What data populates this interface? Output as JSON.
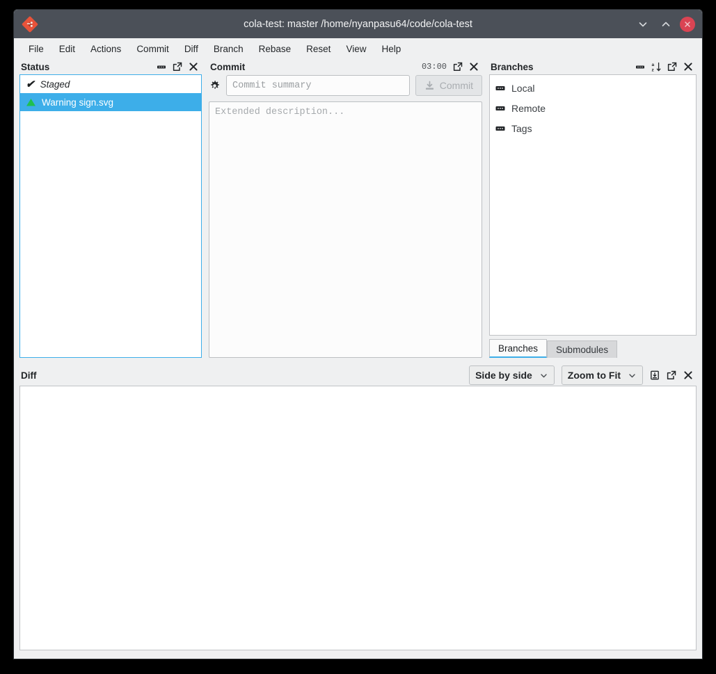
{
  "window": {
    "title": "cola-test: master /home/nyanpasu64/code/cola-test",
    "logo_icon": "git-cola-logo-icon",
    "controls": [
      {
        "name": "minimize-button",
        "icon": "chevron-down-icon"
      },
      {
        "name": "maximize-button",
        "icon": "chevron-up-icon"
      },
      {
        "name": "close-button",
        "icon": "close-x-icon"
      }
    ],
    "titlebar_color": "#4b5058",
    "close_color": "#da4453"
  },
  "menubar": {
    "items": [
      "File",
      "Edit",
      "Actions",
      "Commit",
      "Diff",
      "Branch",
      "Rebase",
      "Reset",
      "View",
      "Help"
    ]
  },
  "status": {
    "title": "Status",
    "icons": [
      "minimize-dock-icon",
      "float-dock-icon",
      "close-dock-icon"
    ],
    "rows": [
      {
        "label": "Staged",
        "icon": "checkmark-icon",
        "selected": false
      },
      {
        "label": "Warning sign.svg",
        "icon": "green-triangle-icon",
        "selected": true
      }
    ],
    "selection_color": "#3daee9",
    "triangle_color": "#20c050"
  },
  "commit": {
    "title": "Commit",
    "timer": "03:00",
    "icons": [
      "float-dock-icon",
      "close-dock-icon"
    ],
    "options_icon": "gear-icon",
    "summary_placeholder": "Commit summary",
    "summary_value": "",
    "description_placeholder": "Extended description...",
    "description_value": "",
    "commit_button_label": "Commit",
    "commit_button_icon": "commit-download-icon",
    "commit_button_enabled": false
  },
  "branches": {
    "title": "Branches",
    "icons": [
      "minimize-dock-icon",
      "sort-az-icon",
      "float-dock-icon",
      "close-dock-icon"
    ],
    "tree": [
      {
        "label": "Local",
        "icon": "branch-group-icon"
      },
      {
        "label": "Remote",
        "icon": "branch-group-icon"
      },
      {
        "label": "Tags",
        "icon": "branch-group-icon"
      }
    ],
    "tabs": [
      {
        "label": "Branches",
        "active": true
      },
      {
        "label": "Submodules",
        "active": false
      }
    ]
  },
  "diff": {
    "title": "Diff",
    "view_mode": "Side by side",
    "zoom_mode": "Zoom to Fit",
    "icons": [
      "save-diff-icon",
      "float-dock-icon",
      "close-dock-icon"
    ],
    "content": ""
  }
}
